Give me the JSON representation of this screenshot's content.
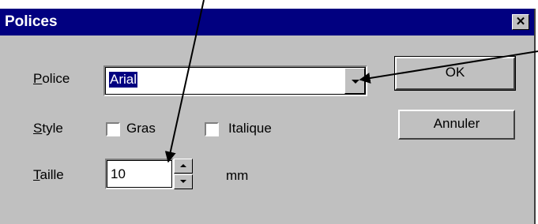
{
  "dialog": {
    "title": "Polices",
    "close_label": "✕",
    "police": {
      "label_key": "P",
      "label_rest": "olice",
      "value": "Arial"
    },
    "style": {
      "label_key": "S",
      "label_rest": "tyle",
      "bold_label": "Gras",
      "bold_checked": false,
      "italic_label": "Italique",
      "italic_checked": false
    },
    "taille": {
      "label_key": "T",
      "label_rest": "aille",
      "value": "10",
      "unit": "mm"
    },
    "ok_label": "OK",
    "cancel_label": "Annuler"
  },
  "colors": {
    "titlebar": "#010080",
    "face": "#c0c0c0",
    "selection": "#010080"
  },
  "icons": [
    "close-icon",
    "dropdown-arrow-icon",
    "spin-up-icon",
    "spin-down-icon"
  ]
}
